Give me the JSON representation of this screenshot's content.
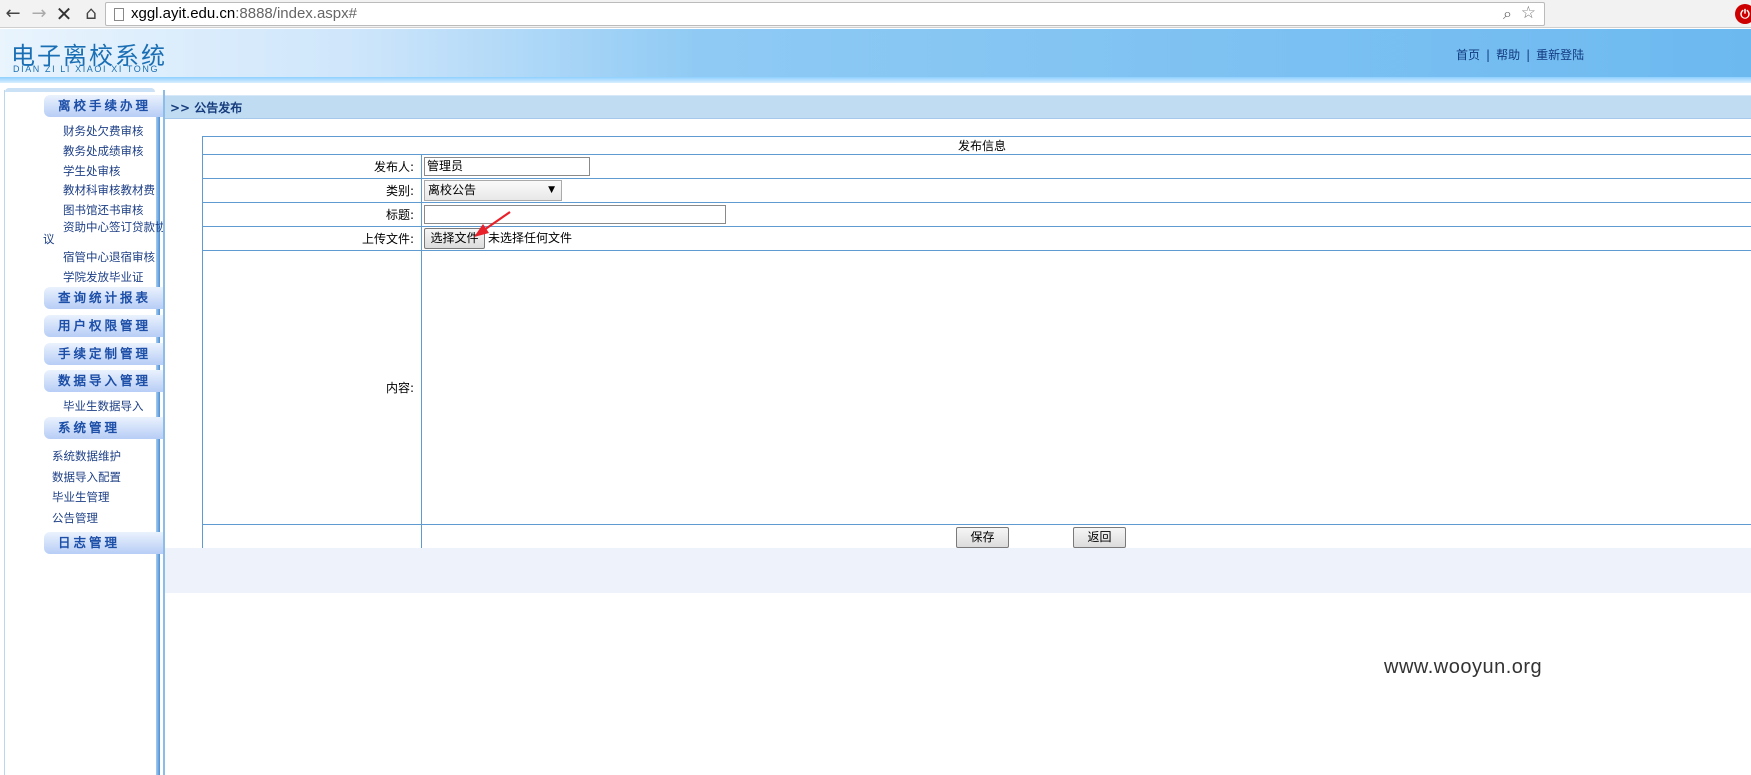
{
  "browser": {
    "url_host": "xggl.ayit.edu.cn",
    "url_rest": ":8888/index.aspx#"
  },
  "header": {
    "logo_cn": "电子离校系统",
    "logo_en": "DIAN ZI LI XIAOI XI TONG",
    "links": [
      "首页",
      "帮助",
      "重新登陆"
    ]
  },
  "sidebar": {
    "sections": [
      {
        "title": "离校手续办理",
        "items": [
          "财务处欠费审核",
          "教务处成绩审核",
          "学生处审核",
          "教材科审核教材费",
          "图书馆还书审核",
          "资助中心签订贷款协",
          "议",
          "宿管中心退宿审核",
          "学院发放毕业证"
        ]
      },
      {
        "title": "查询统计报表",
        "items": []
      },
      {
        "title": "用户权限管理",
        "items": []
      },
      {
        "title": "手续定制管理",
        "items": []
      },
      {
        "title": "数据导入管理",
        "items": [
          "毕业生数据导入"
        ]
      },
      {
        "title": "系统管理",
        "items": [
          "系统数据维护",
          "数据导入配置",
          "毕业生管理",
          "公告管理"
        ]
      },
      {
        "title": "日志管理",
        "items": []
      }
    ]
  },
  "main": {
    "title": ">>  公告发布",
    "form": {
      "header": "发布信息",
      "publisher_label": "发布人:",
      "publisher_value": "管理员",
      "category_label": "类别:",
      "category_value": "离校公告",
      "title_label": "标题:",
      "title_value": "",
      "upload_label": "上传文件:",
      "choose_file_label": "选择文件",
      "file_status": "未选择任何文件",
      "content_label": "内容:",
      "save_label": "保存",
      "back_label": "返回"
    }
  },
  "watermark": "www.wooyun.org"
}
